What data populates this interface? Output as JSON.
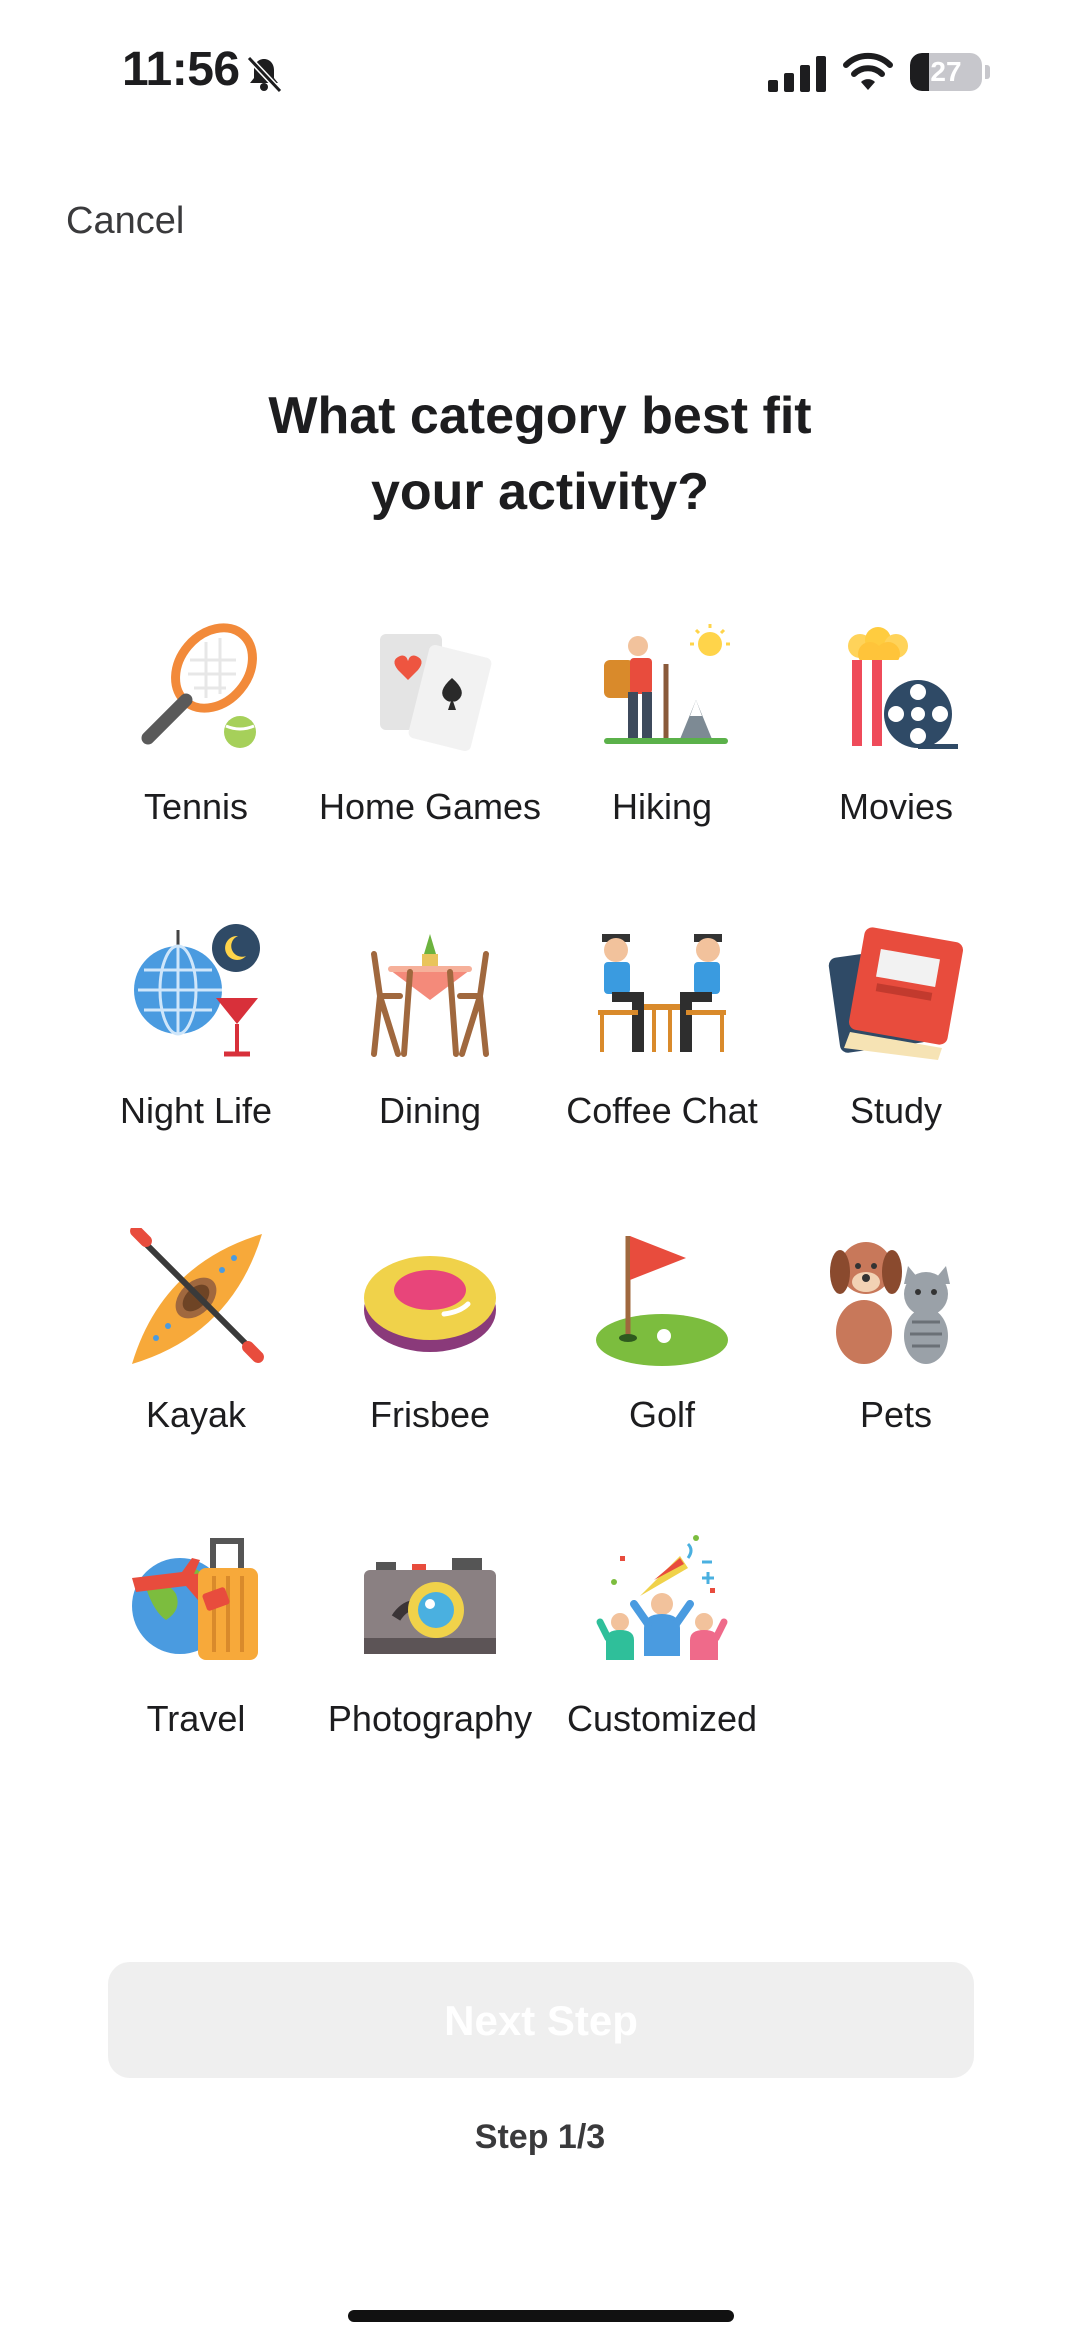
{
  "status_bar": {
    "time": "11:56",
    "battery": "27",
    "battery_level": 0.27
  },
  "header": {
    "cancel_label": "Cancel"
  },
  "question": {
    "line1": "What category best fit",
    "line2": "your activity?"
  },
  "categories": [
    {
      "label": "Tennis",
      "icon": "tennis-icon"
    },
    {
      "label": "Home Games",
      "icon": "playing-cards-icon"
    },
    {
      "label": "Hiking",
      "icon": "hiker-icon"
    },
    {
      "label": "Movies",
      "icon": "popcorn-film-reel-icon"
    },
    {
      "label": "Night Life",
      "icon": "disco-ball-cocktail-icon"
    },
    {
      "label": "Dining",
      "icon": "dining-table-icon"
    },
    {
      "label": "Coffee Chat",
      "icon": "coffee-chat-icon"
    },
    {
      "label": "Study",
      "icon": "books-icon"
    },
    {
      "label": "Kayak",
      "icon": "kayak-icon"
    },
    {
      "label": "Frisbee",
      "icon": "frisbee-icon"
    },
    {
      "label": "Golf",
      "icon": "golf-flag-icon"
    },
    {
      "label": "Pets",
      "icon": "dog-cat-icon"
    },
    {
      "label": "Travel",
      "icon": "globe-suitcase-icon"
    },
    {
      "label": "Photography",
      "icon": "camera-icon"
    },
    {
      "label": "Customized",
      "icon": "party-people-icon"
    }
  ],
  "footer": {
    "next_label": "Next Step",
    "step_text": "Step 1/3"
  }
}
